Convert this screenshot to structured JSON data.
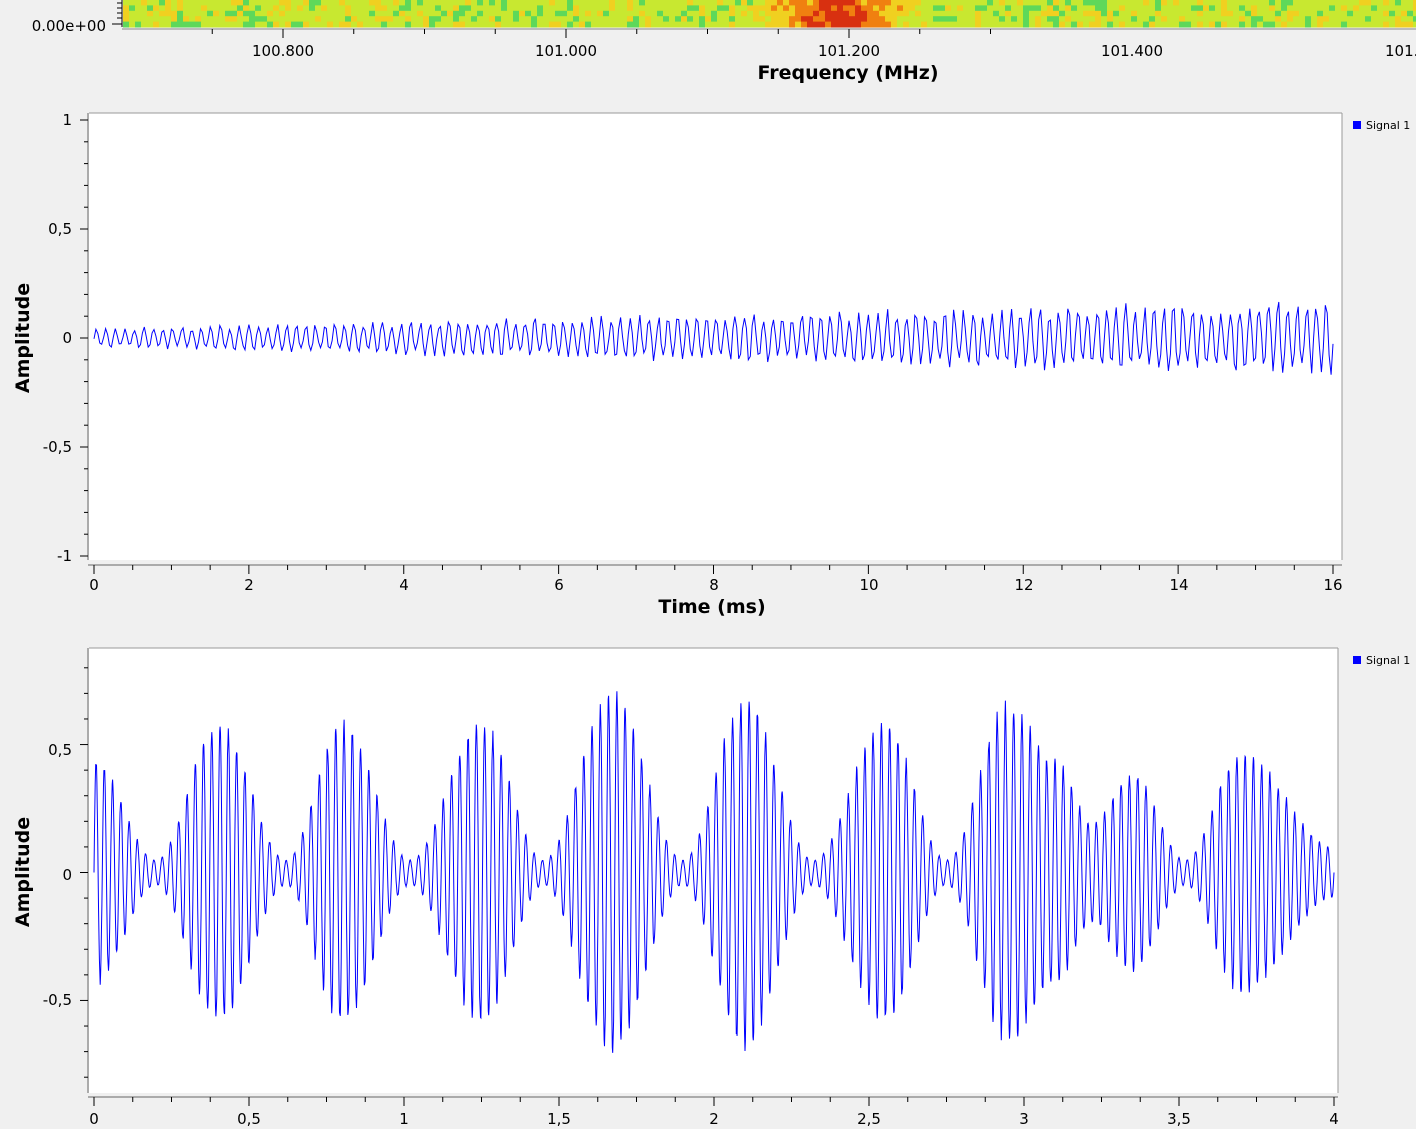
{
  "window": {
    "panels": [
      "waterfall-display",
      "time-domain-display",
      "time-domain-display-2"
    ]
  },
  "colors": {
    "background": "#f0f0f0",
    "plot_bg": "#ffffff",
    "trace": "#0000ff",
    "legend_marker": "#0000ff"
  },
  "waterfall": {
    "y_tick_label": "0.00e+00",
    "xlabel": "Frequency (MHz)",
    "x_ticks": [
      "100.800",
      "101.000",
      "101.200",
      "101.400",
      "101."
    ],
    "colormap": [
      "#3f8fd8",
      "#3ec8b8",
      "#5ed85a",
      "#c8e830",
      "#f0d020",
      "#f08010",
      "#d83010"
    ],
    "hotspot_center_mhz": 101.19
  },
  "chart_data": [
    {
      "type": "line",
      "title": "",
      "xlabel": "Time (ms)",
      "ylabel": "Amplitude",
      "xlim": [
        0,
        16
      ],
      "ylim": [
        -1,
        1
      ],
      "x_ticks": [
        "0",
        "2",
        "4",
        "6",
        "8",
        "10",
        "12",
        "14",
        "16"
      ],
      "y_ticks": [
        "1",
        "0,5",
        "0",
        "-0,5",
        "-1"
      ],
      "legend": {
        "position": "top-right",
        "entries": [
          "Signal 1"
        ]
      },
      "series": [
        {
          "name": "Signal 1",
          "sample_count": 640,
          "envelope_start": 0.05,
          "envelope_end": 0.2,
          "carrier_cycles": 130,
          "noise_level": 0.35
        }
      ]
    },
    {
      "type": "line",
      "title": "",
      "xlabel": "",
      "ylabel": "Amplitude",
      "xlim": [
        0,
        4
      ],
      "ylim": [
        -0.85,
        0.85
      ],
      "x_ticks": [
        "0",
        "0,5",
        "1",
        "1,5",
        "2",
        "2,5",
        "3",
        "3,5",
        "4"
      ],
      "y_ticks": [
        "0,5",
        "0",
        "-0,5"
      ],
      "legend": {
        "position": "top-right",
        "entries": [
          "Signal 1"
        ]
      },
      "series": [
        {
          "name": "Signal 1",
          "carrier_cycles": 150,
          "sample_count": 3000,
          "envelope_peaks_x": [
            0,
            0.4,
            0.8,
            1.25,
            1.67,
            2.1,
            2.55,
            2.95,
            3.1,
            3.35,
            3.7
          ],
          "envelope_peaks_y": [
            0.45,
            0.6,
            0.6,
            0.6,
            0.72,
            0.7,
            0.6,
            0.68,
            0.45,
            0.4,
            0.48
          ],
          "envelope_troughs_x": [
            0.2,
            0.62,
            1.02,
            1.45,
            1.9,
            2.32,
            2.75,
            3.22,
            3.52,
            4.0
          ],
          "envelope_troughs_y": [
            0.05,
            0.05,
            0.05,
            0.05,
            0.05,
            0.05,
            0.05,
            0.2,
            0.05,
            0.1
          ]
        }
      ]
    }
  ]
}
